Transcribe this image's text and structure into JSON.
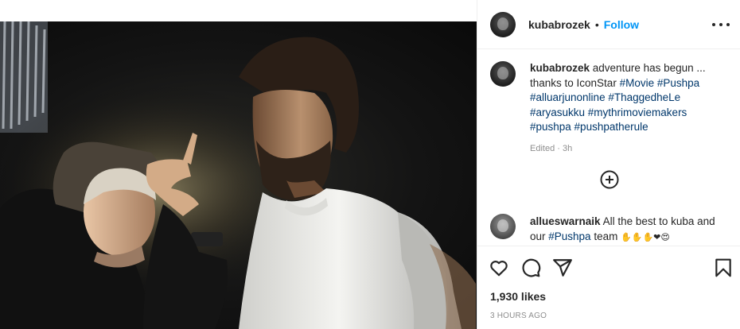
{
  "post": {
    "username": "kubabrozek",
    "dot": "•",
    "follow_label": "Follow",
    "more_icon": "more-horizontal-icon",
    "photo_alt": "Two men on a dark film set; an older man gestures at his temple while a bearded man in a white t-shirt looks on"
  },
  "caption": {
    "username": "kubabrozek",
    "text_1": " adventure has begun ... thanks to IconStar ",
    "tags_1": "#Movie #Pushpa #alluarjunonline #ThaggedheLe #aryasukku #mythrimoviemakers #pushpa #pushpatherule",
    "edited": "Edited",
    "sep": " · ",
    "age": "3h"
  },
  "comment": {
    "username": "allueswarnaik",
    "text_1": " All the best to kuba and our ",
    "tag": "#Pushpa",
    "text_2": " team ",
    "emojis": "✋✋✋❤😍"
  },
  "actions": {
    "like_icon": "heart-icon",
    "comment_icon": "comment-icon",
    "share_icon": "share-icon",
    "save_icon": "bookmark-icon",
    "load_more_icon": "plus-circle-icon"
  },
  "likes": "1,930 likes",
  "timestamp": "3 HOURS AGO",
  "colors": {
    "accent": "#0095f6",
    "hashtag": "#00376b",
    "muted": "#8e8e8e",
    "text": "#262626",
    "border": "#efefef"
  }
}
